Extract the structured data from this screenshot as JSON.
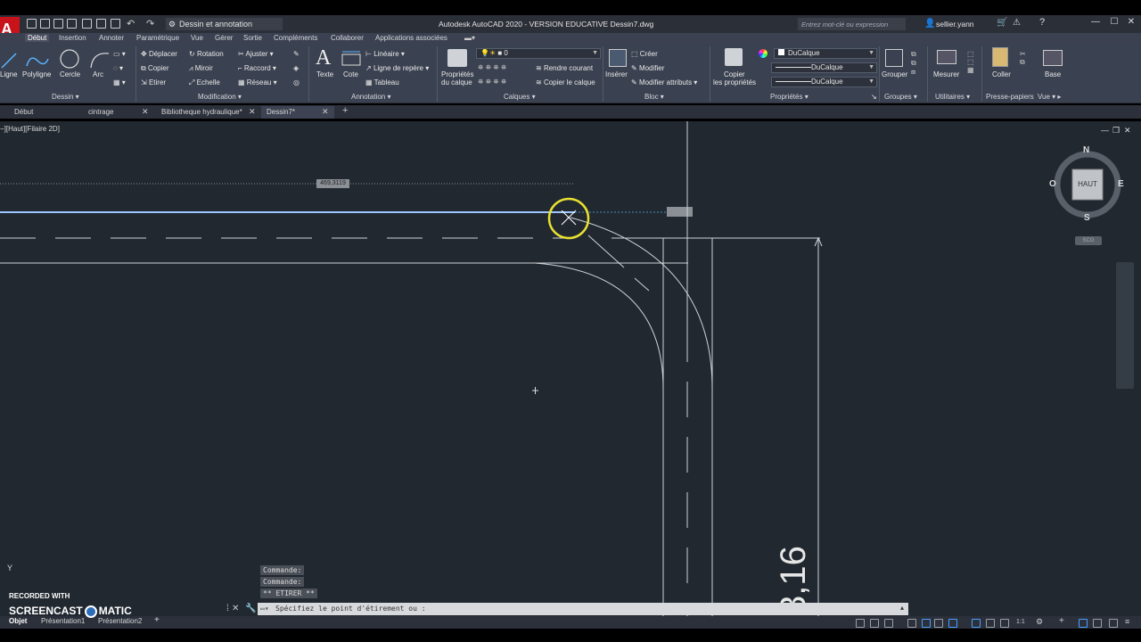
{
  "titlebar": {
    "workspace": "Dessin et annotation",
    "title": "Autodesk AutoCAD 2020 - VERSION EDUCATIVE    Dessin7.dwg",
    "search_placeholder": "Entrez mot-clé ou expression",
    "user": "sellier.yann"
  },
  "ribbon_tabs": [
    "Début",
    "Insertion",
    "Annoter",
    "Paramétrique",
    "Vue",
    "Gérer",
    "Sortie",
    "Compléments",
    "Collaborer",
    "Applications associées"
  ],
  "ribbon": {
    "dessin": {
      "title": "Dessin",
      "ligne": "Ligne",
      "polyligne": "Polyligne",
      "cercle": "Cercle",
      "arc": "Arc"
    },
    "modification": {
      "title": "Modification",
      "deplacer": "Déplacer",
      "rotation": "Rotation",
      "ajuster": "Ajuster",
      "copier": "Copier",
      "miroir": "Miroir",
      "raccord": "Raccord",
      "etirer": "Etirer",
      "echelle": "Echelle",
      "reseau": "Réseau"
    },
    "annotation": {
      "title": "Annotation",
      "texte": "Texte",
      "cote": "Cote",
      "lineaire": "Linéaire",
      "ligne_repere": "Ligne de repère",
      "tableau": "Tableau"
    },
    "calques": {
      "title": "Calques",
      "proprietes_1": "Propriétés",
      "proprietes_2": "du calque",
      "layer_value": "0",
      "rendre_courant": "Rendre courant",
      "copier_calque": "Copier le calque"
    },
    "bloc": {
      "title": "Bloc",
      "inserer": "Insérer",
      "creer": "Créer",
      "modifier": "Modifier",
      "modifier_attributs": "Modifier attributs"
    },
    "proprietes": {
      "title": "Propriétés",
      "copier_1": "Copier",
      "copier_2": "les propriétés",
      "color": "DuCalque",
      "linetype": "DuCalque",
      "lineweight": "DuCalque"
    },
    "groupes": {
      "title": "Groupes",
      "grouper": "Grouper"
    },
    "utilitaires": {
      "title": "Utilitaires",
      "mesurer": "Mesurer"
    },
    "presse_papiers": {
      "title": "Presse-papiers",
      "coller": "Coller"
    },
    "vue": {
      "title": "Vue",
      "base": "Base"
    }
  },
  "doc_tabs": [
    "Début",
    "cintrage",
    "Bibliotheque hydraulique*",
    "Dessin7*"
  ],
  "viewport": {
    "label": "−][Haut][Filaire 2D]"
  },
  "viewcube": {
    "face": "HAUT",
    "north": "N",
    "south": "S",
    "east": "E",
    "west": "O",
    "ucs": "SCG"
  },
  "drawing": {
    "dim_tooltip": "469,3119",
    "dim_text": "3,16"
  },
  "command": {
    "history": [
      "Commande:",
      "Commande:",
      "** ETIRER **"
    ],
    "prompt": "Spécifiez le point d'étirement ou :"
  },
  "layout_tabs": [
    "Objet",
    "Présentation1",
    "Présentation2"
  ],
  "watermark": {
    "line1": "RECORDED WITH",
    "line2a": "SCREENCAST",
    "line2b": "MATIC"
  },
  "ucs_axis": "Y",
  "colors": {
    "accent": "#c8131b",
    "canvas": "#212830",
    "ribbon": "#3a4150",
    "highlight": "#e8e030"
  }
}
